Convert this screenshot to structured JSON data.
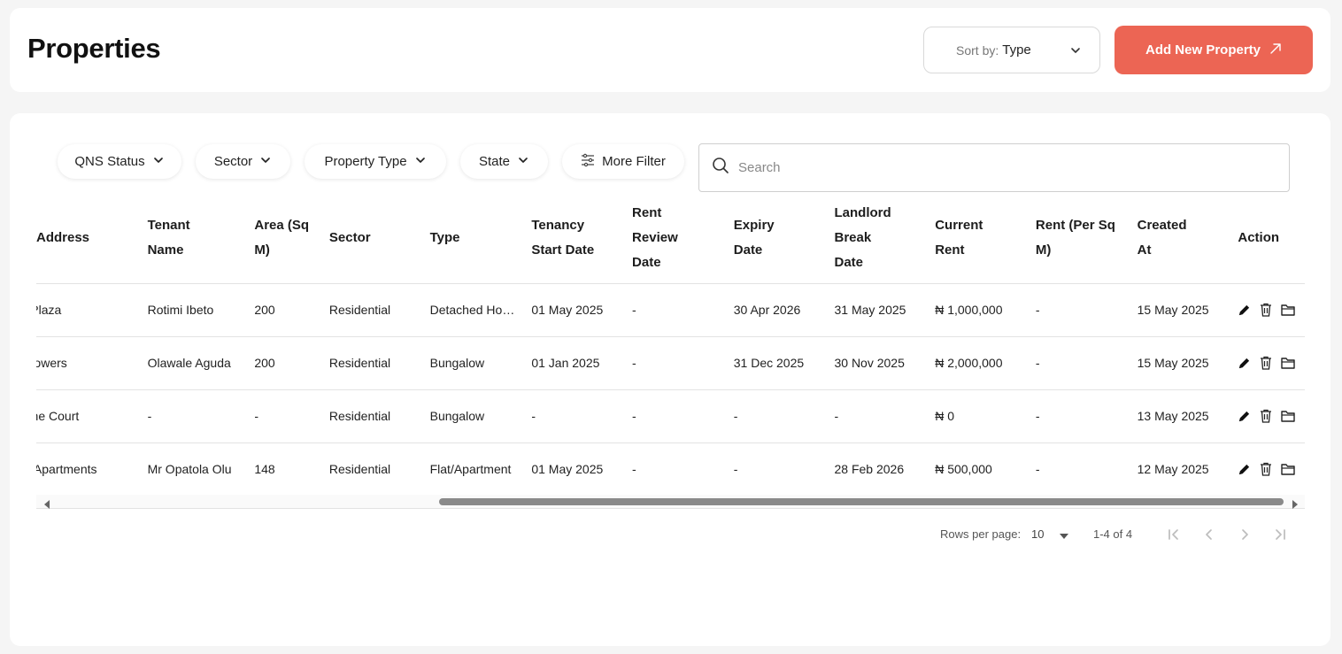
{
  "header": {
    "title": "Properties",
    "sort_label": "Sort by:",
    "sort_value": "Type",
    "add_button": "Add New Property",
    "accent_color": "#ec6554"
  },
  "filters": [
    {
      "label": "QNS Status"
    },
    {
      "label": "Sector"
    },
    {
      "label": "Property Type"
    },
    {
      "label": "State"
    },
    {
      "label": "More Filter"
    }
  ],
  "search": {
    "placeholder": "Search"
  },
  "table": {
    "columns": [
      "Address",
      "Tenant Name",
      "Area (Sq M)",
      "Sector",
      "Type",
      "Tenancy Start Date",
      "Rent Review Date",
      "Expiry Date",
      "Landlord Break Date",
      "Current Rent",
      "Rent (Per Sq M)",
      "Created At",
      "Action"
    ],
    "rows": [
      [
        "Yone Plaza",
        "Rotimi Ibeto",
        "200",
        "Residential",
        "Detached House",
        "01 May 2025",
        "-",
        "30 Apr 2026",
        "31 May 2025",
        "₦ 1,000,000",
        "-",
        "15 May 2025"
      ],
      [
        "Yme Towers",
        "Olawale Aguda",
        "200",
        "Residential",
        "Bungalow",
        "01 Jan 2025",
        "-",
        "31 Dec 2025",
        "30 Nov 2025",
        "₦ 2,000,000",
        "-",
        "15 May 2025"
      ],
      [
        "Jasmine Court",
        "-",
        "-",
        "Residential",
        "Bungalow",
        "-",
        "-",
        "-",
        "-",
        "₦ 0",
        "-",
        "13 May 2025"
      ],
      [
        "Royal Apartments",
        "Mr Opatola Olu",
        "148",
        "Residential",
        "Flat/Apartment",
        "01 May 2025",
        "-",
        "-",
        "28 Feb 2026",
        "₦ 500,000",
        "-",
        "12 May 2025"
      ]
    ]
  },
  "pagination": {
    "rows_per_page_label": "Rows per page:",
    "rows_per_page": "10",
    "range": "1-4 of 4"
  }
}
